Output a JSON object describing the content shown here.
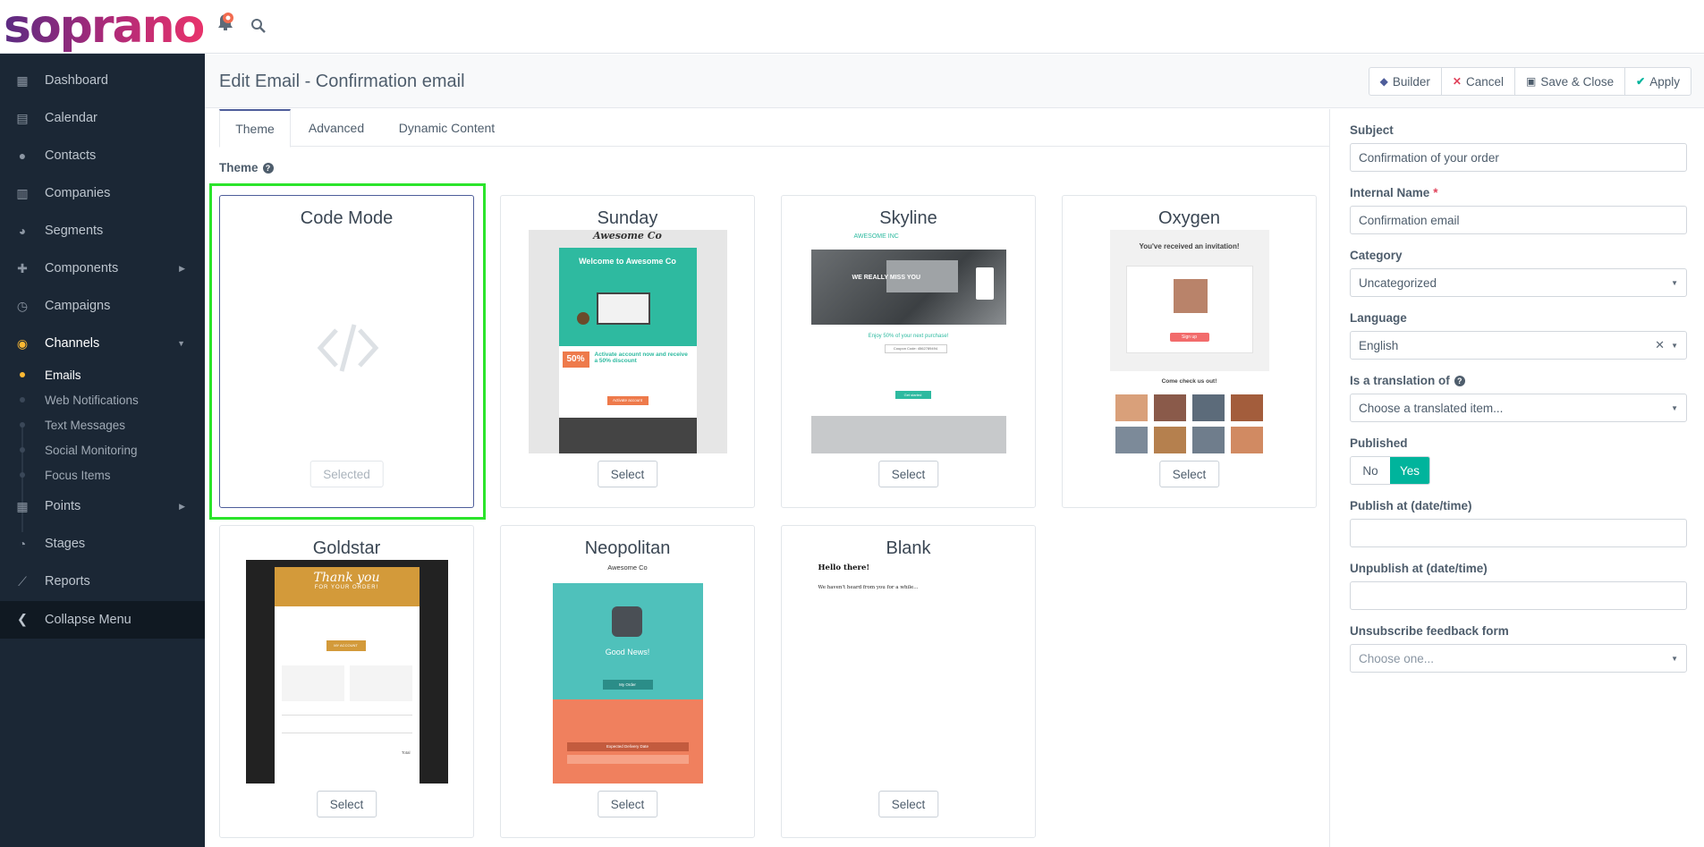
{
  "app": {
    "logo": "soprano"
  },
  "header": {
    "title": "Edit Email - Confirmation email",
    "buttons": {
      "builder": "Builder",
      "cancel": "Cancel",
      "save_close": "Save & Close",
      "apply": "Apply"
    }
  },
  "sidebar": {
    "items": [
      {
        "label": "Dashboard",
        "icon": "dashboard-icon"
      },
      {
        "label": "Calendar",
        "icon": "calendar-icon"
      },
      {
        "label": "Contacts",
        "icon": "user-icon"
      },
      {
        "label": "Companies",
        "icon": "building-icon"
      },
      {
        "label": "Segments",
        "icon": "pie-chart-icon"
      },
      {
        "label": "Components",
        "icon": "puzzle-icon"
      },
      {
        "label": "Campaigns",
        "icon": "clock-icon"
      },
      {
        "label": "Channels",
        "icon": "rss-icon"
      },
      {
        "label": "Points",
        "icon": "calculator-icon"
      },
      {
        "label": "Stages",
        "icon": "tachometer-icon"
      },
      {
        "label": "Reports",
        "icon": "line-chart-icon"
      }
    ],
    "channels_sub": [
      "Emails",
      "Web Notifications",
      "Text Messages",
      "Social Monitoring",
      "Focus Items"
    ],
    "collapse": "Collapse Menu"
  },
  "tabs": [
    "Theme",
    "Advanced",
    "Dynamic Content"
  ],
  "theme": {
    "label": "Theme",
    "cards": [
      {
        "name": "Code Mode",
        "button": "Selected"
      },
      {
        "name": "Sunday",
        "button": "Select"
      },
      {
        "name": "Skyline",
        "button": "Select"
      },
      {
        "name": "Oxygen",
        "button": "Select"
      },
      {
        "name": "Goldstar",
        "button": "Select"
      },
      {
        "name": "Neopolitan",
        "button": "Select"
      },
      {
        "name": "Blank",
        "button": "Select"
      }
    ],
    "previews": {
      "sunday": {
        "brand": "Awesome Co",
        "headline": "Welcome to Awesome Co",
        "percent": "50%",
        "offer": "Activate account now and receive a 50% discount",
        "cta": "Activate account"
      },
      "skyline": {
        "brand": "AWESOME INC",
        "hero": "WE REALLY MISS YOU",
        "offer": "Enjoy 50% of your next purchase!",
        "coupon": "Coupon Code: 4562789494",
        "cta": "Get started"
      },
      "oxygen": {
        "headline": "You've received an invitation!",
        "cta": "Sign up",
        "footer": "Come check us out!"
      },
      "goldstar": {
        "headline": "Thank you",
        "sub": "FOR YOUR ORDER!",
        "cta": "MY ACCOUNT",
        "total": "Total"
      },
      "neopolitan": {
        "brand": "Awesome Co",
        "headline": "Good News!",
        "cta": "My Order",
        "delivery": "Expected Delivery Date"
      },
      "blank": {
        "greeting": "Hello there!",
        "body": "We haven't heard from you for a while..."
      }
    }
  },
  "form": {
    "subject": {
      "label": "Subject",
      "value": "Confirmation of your order"
    },
    "internal_name": {
      "label": "Internal Name",
      "required": "*",
      "value": "Confirmation email"
    },
    "category": {
      "label": "Category",
      "value": "Uncategorized"
    },
    "language": {
      "label": "Language",
      "value": "English"
    },
    "translation": {
      "label": "Is a translation of",
      "placeholder": "Choose a translated item..."
    },
    "published": {
      "label": "Published",
      "no": "No",
      "yes": "Yes",
      "value": "Yes"
    },
    "publish_at": {
      "label": "Publish at (date/time)",
      "value": ""
    },
    "unpublish_at": {
      "label": "Unpublish at (date/time)",
      "value": ""
    },
    "unsubscribe": {
      "label": "Unsubscribe feedback form",
      "placeholder": "Choose one..."
    }
  }
}
